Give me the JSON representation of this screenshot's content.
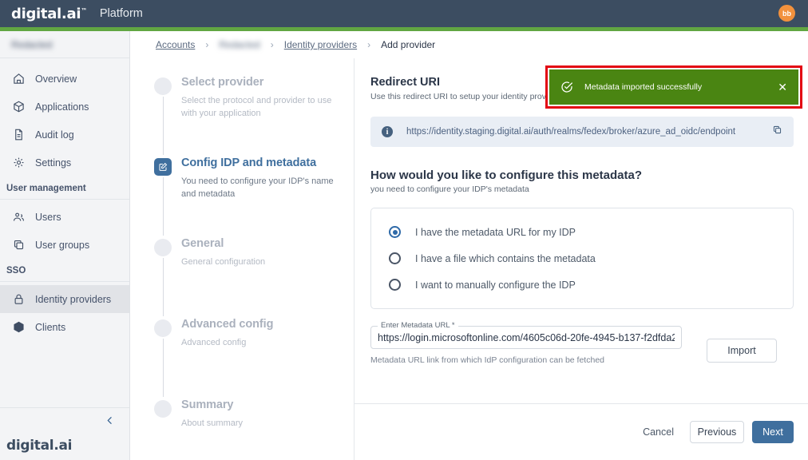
{
  "header": {
    "logo_text": "digital.ai",
    "product": "Platform",
    "avatar_initials": "bb",
    "accent_color": "#61a642",
    "bg_color": "#3c4d61",
    "avatar_color": "#f2913d"
  },
  "sidebar": {
    "account_name_redacted": "Redacted",
    "items": [
      {
        "label": "Overview",
        "icon": "home-icon",
        "active": false
      },
      {
        "label": "Applications",
        "icon": "package-icon",
        "active": false
      },
      {
        "label": "Audit log",
        "icon": "document-icon",
        "active": false
      },
      {
        "label": "Settings",
        "icon": "gear-icon",
        "active": false
      }
    ],
    "group_user_management": "User management",
    "user_items": [
      {
        "label": "Users",
        "icon": "users-icon",
        "active": false
      },
      {
        "label": "User groups",
        "icon": "copy-icon",
        "active": false
      }
    ],
    "group_sso": "SSO",
    "sso_items": [
      {
        "label": "Identity providers",
        "icon": "lock-icon",
        "active": true
      },
      {
        "label": "Clients",
        "icon": "cube-icon",
        "active": false
      }
    ],
    "footer_logo": "digital.ai"
  },
  "breadcrumb": {
    "items": [
      {
        "label": "Accounts",
        "type": "link"
      },
      {
        "label": "Redacted",
        "type": "blurred"
      },
      {
        "label": "Identity providers",
        "type": "link"
      },
      {
        "label": "Add provider",
        "type": "current"
      }
    ],
    "separator": "›"
  },
  "stepper": {
    "steps": [
      {
        "title": "Select provider",
        "desc": "Select the protocol and provider to use with your application",
        "state": "pending"
      },
      {
        "title": "Config IDP and metadata",
        "desc": "You need to configure your IDP's name and metadata",
        "state": "current",
        "icon": "edit-square-icon"
      },
      {
        "title": "General",
        "desc": "General configuration",
        "state": "pending"
      },
      {
        "title": "Advanced config",
        "desc": "Advanced config",
        "state": "pending"
      },
      {
        "title": "Summary",
        "desc": "About summary",
        "state": "pending"
      }
    ]
  },
  "main": {
    "redirect_title": "Redirect URI",
    "redirect_sub": "Use this redirect URI to setup your identity provider",
    "redirect_uri": "https://identity.staging.digital.ai/auth/realms/fedex/broker/azure_ad_oidc/endpoint",
    "question_title": "How would you like to configure this metadata?",
    "question_sub": "you need to configure your IDP's metadata",
    "options": [
      {
        "label": "I have the metadata URL for my IDP",
        "selected": true
      },
      {
        "label": "I have a file which contains the metadata",
        "selected": false
      },
      {
        "label": "I want to manually configure the IDP",
        "selected": false
      }
    ],
    "metadata_field_label": "Enter Metadata URL *",
    "metadata_field_value": "https://login.microsoftonline.com/4605c06d-20fe-4945-b137-f2dfda2",
    "metadata_field_help": "Metadata URL link from which IdP configuration can be fetched",
    "import_label": "Import"
  },
  "footer": {
    "cancel_label": "Cancel",
    "previous_label": "Previous",
    "next_label": "Next",
    "primary_color": "#3f6f9e"
  },
  "toast": {
    "message": "Metadata imported successfully",
    "icon": "check-circle-icon",
    "close_icon": "close-icon",
    "bg_color": "#4a8512",
    "highlight_color": "#e30613"
  }
}
